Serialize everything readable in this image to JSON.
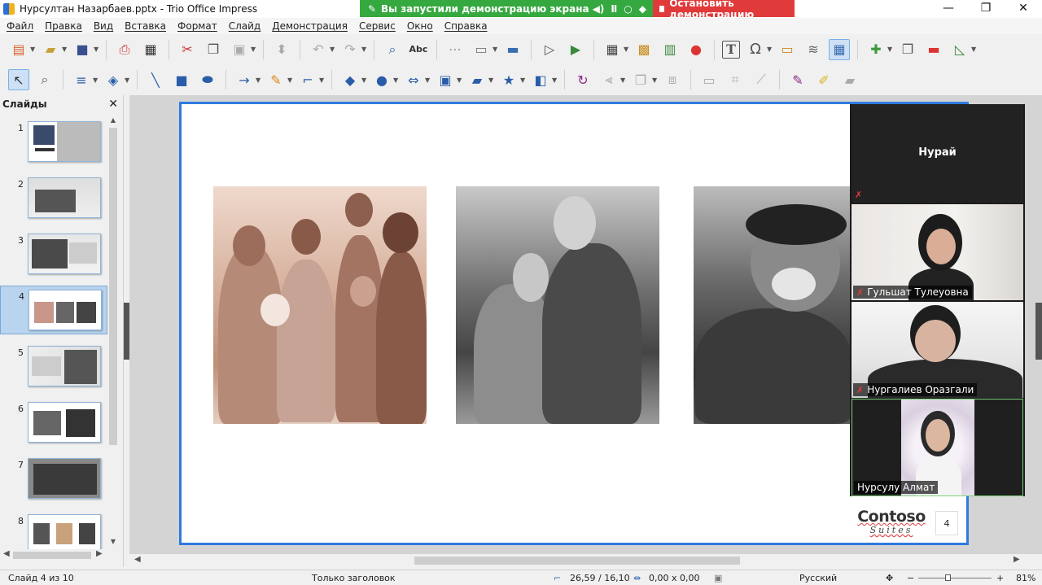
{
  "window": {
    "title": "Нурсултан Назарбаев.pptx - Trio Office Impress",
    "controls": {
      "minimize": "—",
      "maximize": "❐",
      "close": "✕"
    }
  },
  "share_banner": {
    "status_text": "Вы запустили демонстрацию экрана",
    "stop_label": "Остановить демонстрацию",
    "color_green": "#35a83f",
    "color_red": "#e03a3a"
  },
  "menu": {
    "items": [
      "Файл",
      "Правка",
      "Вид",
      "Вставка",
      "Формат",
      "Слайд",
      "Демонстрация",
      "Сервис",
      "Окно",
      "Справка"
    ]
  },
  "toolbar_top": {
    "icons": [
      "new-document-icon",
      "open-icon",
      "save-icon",
      "export-pdf-icon",
      "print-icon",
      "cut-icon",
      "copy-icon",
      "paste-icon",
      "clone-formatting-icon",
      "undo-icon",
      "redo-icon",
      "find-replace-icon",
      "spellcheck-icon",
      "grid-icon",
      "display-views-icon",
      "master-slide-icon",
      "start-presentation-icon",
      "start-current-icon",
      "table-icon",
      "image-icon",
      "chart-icon",
      "media-icon",
      "textbox-icon",
      "special-char-icon",
      "fontwork-icon",
      "transform-icon",
      "show-draw-icon",
      "new-slide-icon",
      "duplicate-slide-icon",
      "delete-slide-icon",
      "slide-layout-icon"
    ],
    "spellcheck_glyph": "Abc",
    "textbox_glyph": "T",
    "special_char_glyph": "Ω"
  },
  "toolbar_draw": {
    "icons": [
      "select-icon",
      "zoom-icon",
      "line-color-icon",
      "fill-color-icon",
      "line-icon",
      "rectangle-icon",
      "ellipse-icon",
      "arrow-line-icon",
      "curve-icon",
      "connector-icon",
      "diamond-icon",
      "smiley-icon",
      "block-arrow-icon",
      "flowchart-icon",
      "callout-icon",
      "star-icon",
      "3d-object-icon",
      "rotate-icon",
      "align-icon",
      "arrange-icon",
      "distribute-icon",
      "shadow-icon",
      "crop-icon",
      "filter-icon",
      "points-icon",
      "glue-icon",
      "toggle-extrusion-icon"
    ]
  },
  "sidebar": {
    "title": "Слайды",
    "close_label": "✕",
    "slides": [
      {
        "number": "1"
      },
      {
        "number": "2"
      },
      {
        "number": "3"
      },
      {
        "number": "4",
        "selected": true
      },
      {
        "number": "5"
      },
      {
        "number": "6"
      },
      {
        "number": "7"
      },
      {
        "number": "8"
      }
    ],
    "selected_slide": 4
  },
  "slide": {
    "logo_main": "Contoso",
    "logo_sub": "Suites",
    "slide_number": "4",
    "photos": [
      "family-photo",
      "mother-son-photo",
      "elder-portrait-photo"
    ]
  },
  "video_panel": {
    "participants": [
      {
        "name": "Нурай",
        "muted": true,
        "camera": false
      },
      {
        "name": "Гульшат Тулеуовна",
        "muted": true,
        "camera": true
      },
      {
        "name": "Нургалиев Оразгали",
        "muted": true,
        "camera": true
      },
      {
        "name": "Нурсулу Алмат",
        "muted": false,
        "camera": true,
        "active_speaker": true
      }
    ],
    "mute_glyph": "✗"
  },
  "status": {
    "slide_info": "Слайд 4 из 10",
    "layout_name": "Только заголовок",
    "position": "26,59 / 16,10",
    "size": "0,00 x 0,00",
    "language": "Русский",
    "zoom": "81%",
    "zoom_minus": "−",
    "zoom_plus": "+"
  }
}
